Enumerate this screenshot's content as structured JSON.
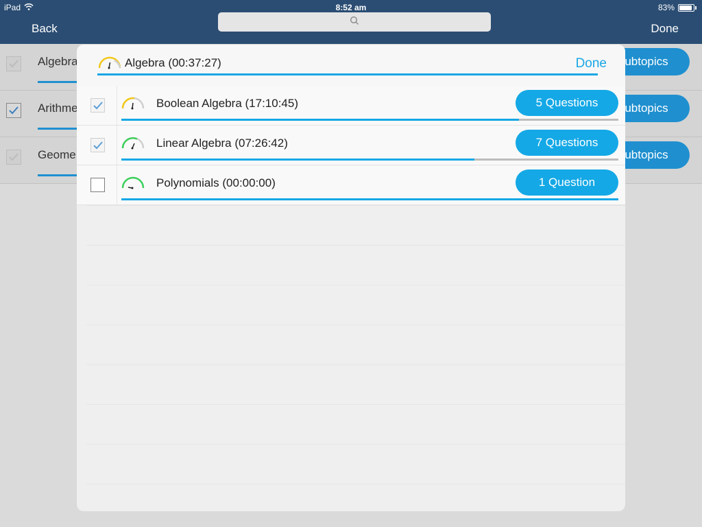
{
  "status_bar": {
    "carrier": "iPad",
    "time": "8:52 am",
    "battery": "83%",
    "battery_level": 0.83
  },
  "nav": {
    "back_label": "Back",
    "done_label": "Done"
  },
  "background_topics": [
    {
      "label": "Algebra",
      "checked": true,
      "button": "Subtopics"
    },
    {
      "label": "Arithme",
      "checked": true,
      "button": "Subtopics"
    },
    {
      "label": "Geome",
      "checked": true,
      "button": "Subtopics"
    }
  ],
  "background_button_visible": "ubtopics",
  "modal": {
    "title": "Algebra (00:37:27)",
    "done_label": "Done",
    "subtopics": [
      {
        "label": "Boolean Algebra  (17:10:45)",
        "questions": "5 Questions",
        "checked": true,
        "progress": 0.8,
        "gauge_color": "#f2c81a",
        "gauge_level": 0.45
      },
      {
        "label": "Linear Algebra  (07:26:42)",
        "questions": "7 Questions",
        "checked": true,
        "progress": 0.71,
        "gauge_color": "#3ccf5a",
        "gauge_level": 0.55
      },
      {
        "label": "Polynomials  (00:00:00)",
        "questions": "1 Question",
        "checked": false,
        "progress": 1.0,
        "gauge_color": "#3ccf5a",
        "gauge_level": 0.0
      }
    ]
  },
  "colors": {
    "nav_bg": "#2b4d73",
    "accent": "#14a8e6"
  },
  "icons": {
    "search": "search-icon",
    "wifi": "wifi-icon",
    "check": "checkmark-icon",
    "gauge": "gauge-icon"
  }
}
